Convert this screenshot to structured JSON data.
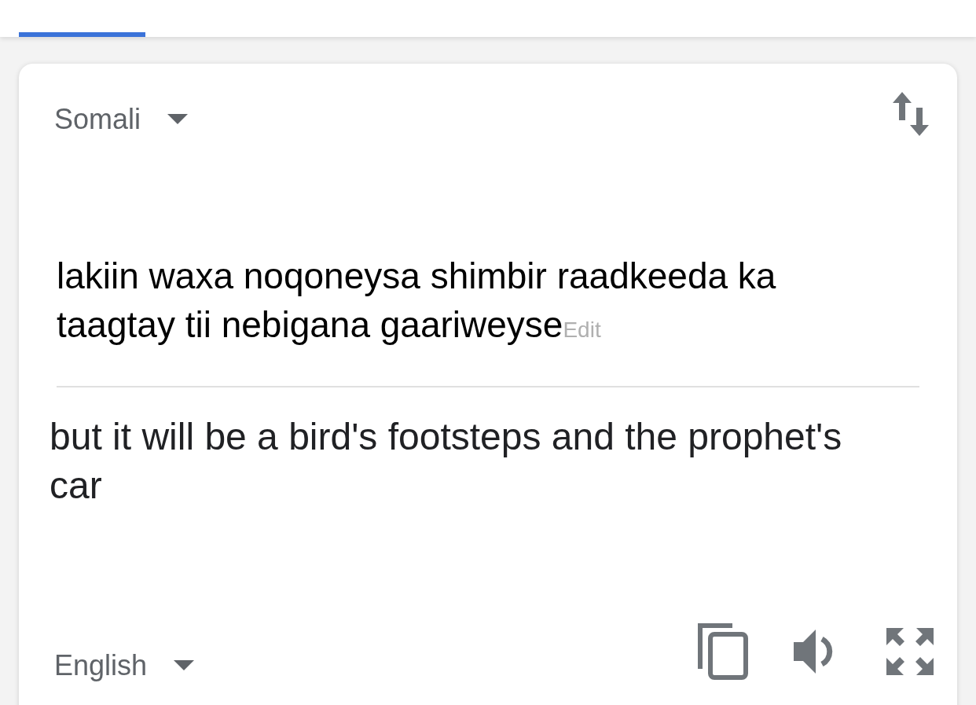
{
  "source": {
    "language": "Somali",
    "text": "lakiin waxa noqoneysa shimbir raadkeeda ka taagtay tii nebigana gaariweyse",
    "edit": "Edit"
  },
  "target": {
    "language": "English",
    "text": "but it will be a bird's footsteps and the prophet's car"
  }
}
